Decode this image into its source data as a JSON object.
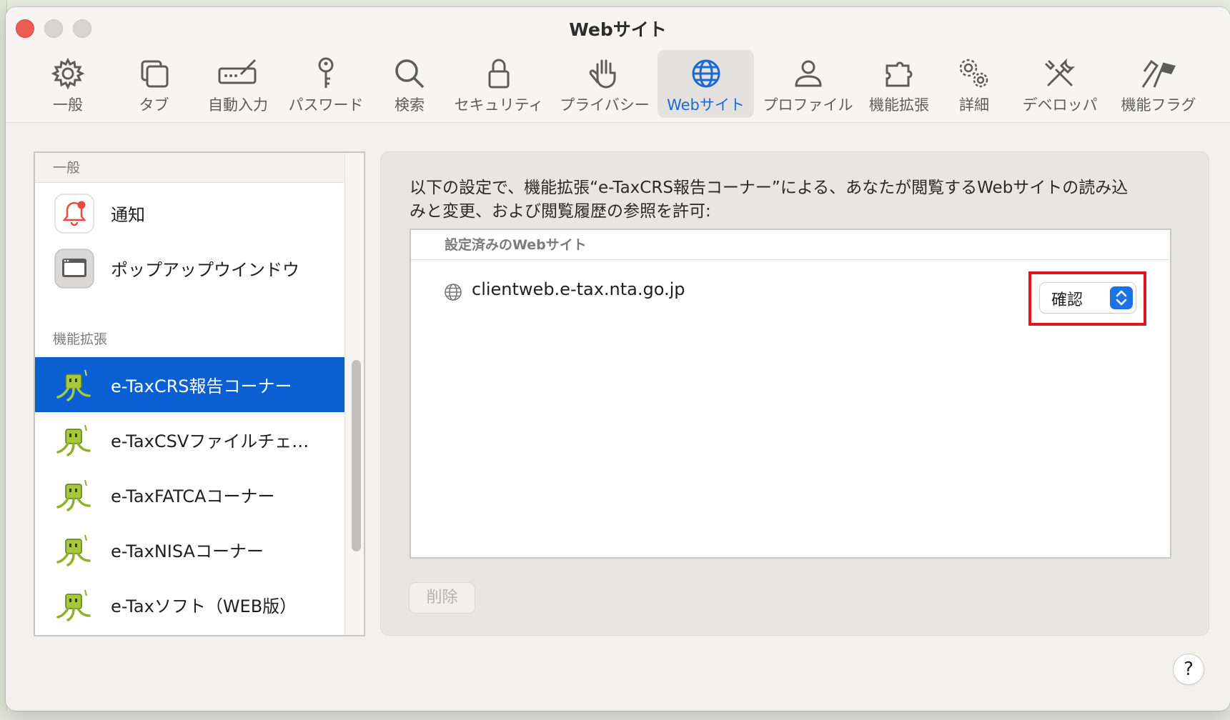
{
  "window": {
    "title": "Webサイト"
  },
  "toolbar": {
    "items": [
      {
        "label": "一般",
        "icon": "gear-icon"
      },
      {
        "label": "タブ",
        "icon": "tabs-icon"
      },
      {
        "label": "自動入力",
        "icon": "autofill-icon"
      },
      {
        "label": "パスワード",
        "icon": "key-icon"
      },
      {
        "label": "検索",
        "icon": "search-icon"
      },
      {
        "label": "セキュリティ",
        "icon": "lock-icon"
      },
      {
        "label": "プライバシー",
        "icon": "hand-icon"
      },
      {
        "label": "Webサイト",
        "icon": "globe-icon",
        "active": true
      },
      {
        "label": "プロファイル",
        "icon": "person-icon"
      },
      {
        "label": "機能拡張",
        "icon": "puzzle-icon"
      },
      {
        "label": "詳細",
        "icon": "gears-icon"
      },
      {
        "label": "デベロッパ",
        "icon": "tools-icon"
      },
      {
        "label": "機能フラグ",
        "icon": "flags-icon"
      }
    ]
  },
  "sidebar": {
    "general_header": "一般",
    "general_items": [
      {
        "label": "通知",
        "icon": "notification-bell-icon"
      },
      {
        "label": "ポップアップウインドウ",
        "icon": "popup-window-icon"
      }
    ],
    "extensions_header": "機能拡張",
    "extension_items": [
      {
        "label": "e-TaxCRS報告コーナー",
        "icon": "etax-mascot-icon",
        "selected": true
      },
      {
        "label": "e-TaxCSVファイルチェ…",
        "icon": "etax-mascot-icon"
      },
      {
        "label": "e-TaxFATCAコーナー",
        "icon": "etax-mascot-icon"
      },
      {
        "label": "e-TaxNISAコーナー",
        "icon": "etax-mascot-icon"
      },
      {
        "label": "e-Taxソフト（WEB版）",
        "icon": "etax-mascot-icon"
      }
    ]
  },
  "content": {
    "description_line1": "以下の設定で、機能拡張“e-TaxCRS報告コーナー”による、あなたが閲覧するWebサイトの読み込",
    "description_line2": "みと変更、および閲覧履歴の参照を許可:",
    "table_header": "設定済みのWebサイト",
    "sites": [
      {
        "domain": "clientweb.e-tax.nta.go.jp",
        "permission": "確認"
      }
    ],
    "delete_label": "削除"
  },
  "help": {
    "label": "?"
  },
  "colors": {
    "accent": "#0a5fd3",
    "highlight": "#e01422",
    "close": "#ee5b55"
  }
}
